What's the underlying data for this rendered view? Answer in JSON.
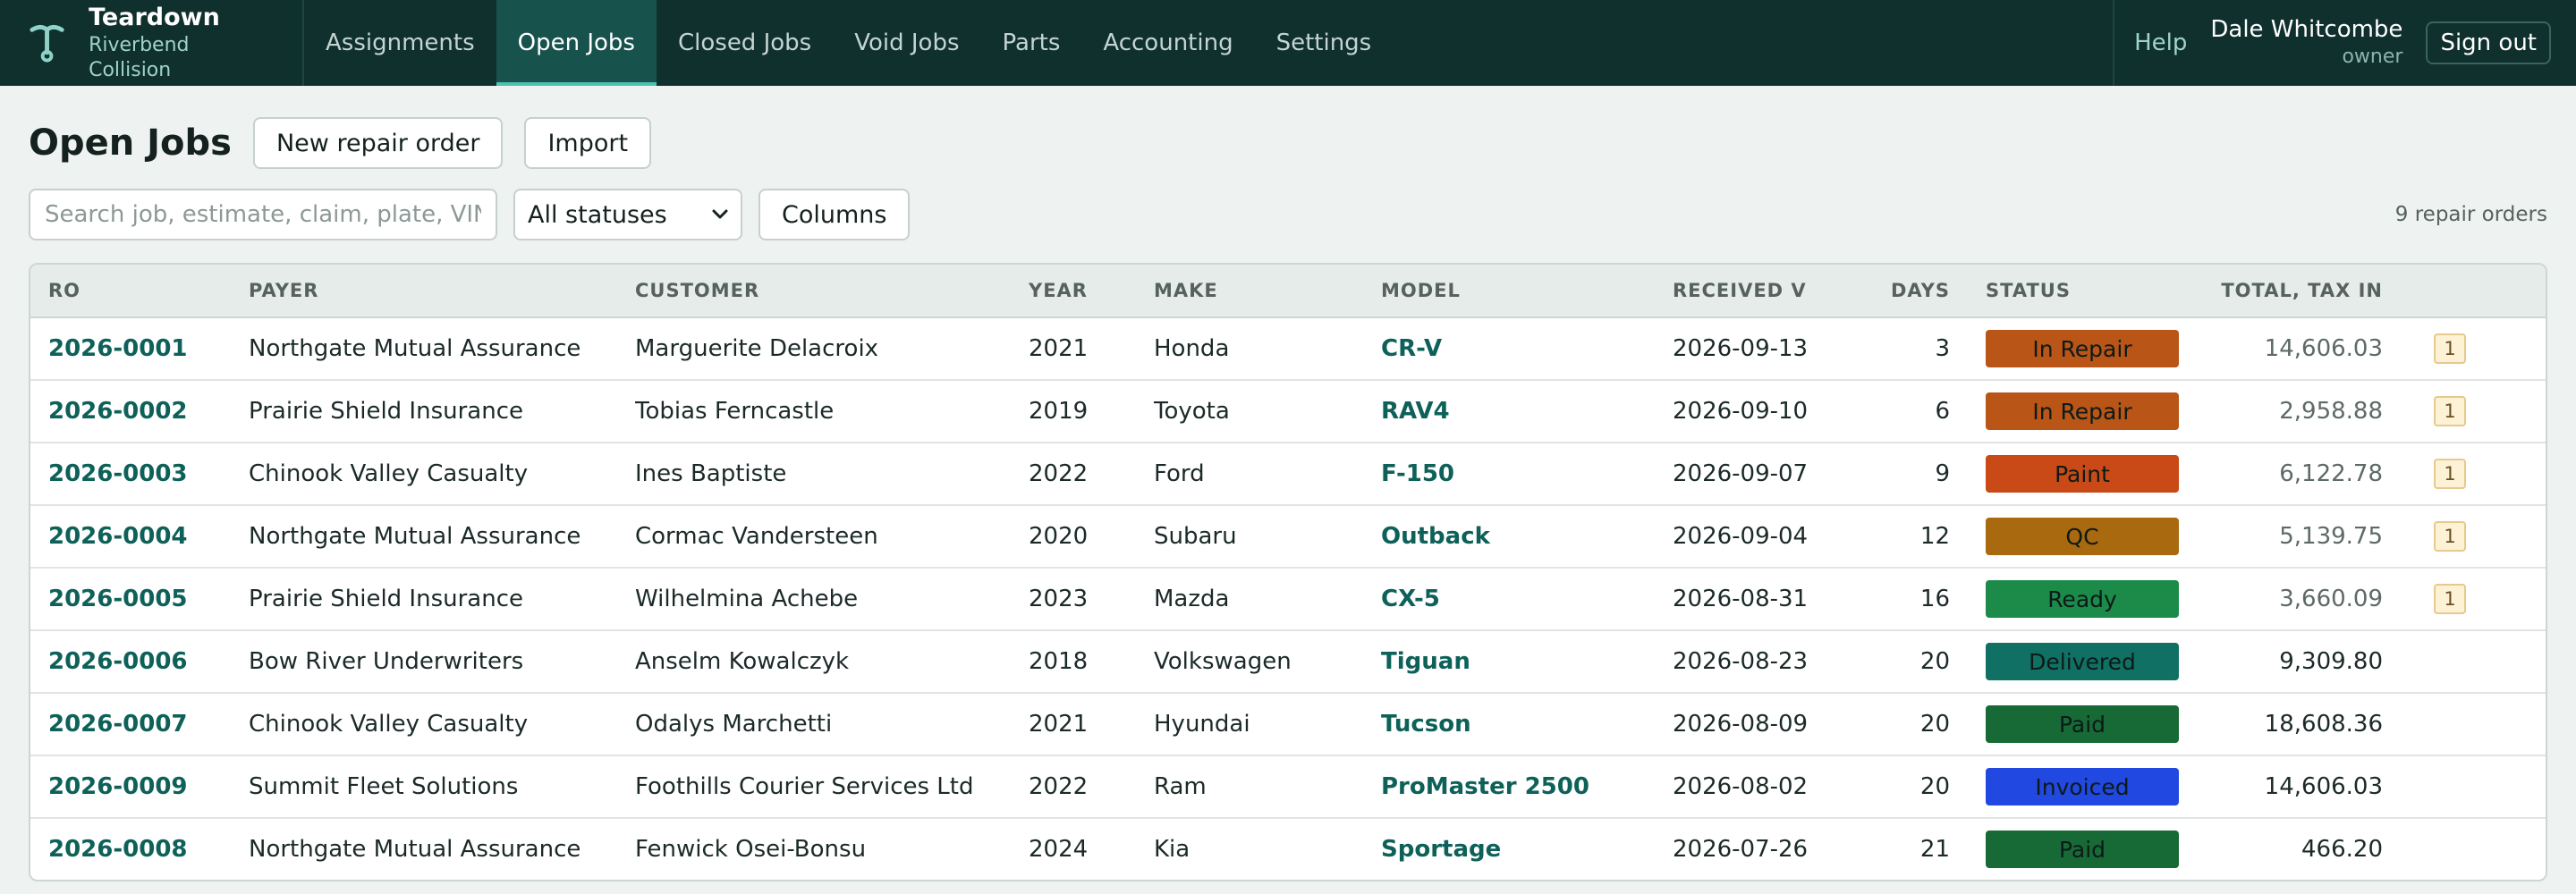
{
  "brand": {
    "name": "Teardown",
    "sub": "Riverbend Collision"
  },
  "nav": [
    {
      "label": "Assignments",
      "active": false
    },
    {
      "label": "Open Jobs",
      "active": true
    },
    {
      "label": "Closed Jobs",
      "active": false
    },
    {
      "label": "Void Jobs",
      "active": false
    },
    {
      "label": "Parts",
      "active": false
    },
    {
      "label": "Accounting",
      "active": false
    },
    {
      "label": "Settings",
      "active": false
    }
  ],
  "topright": {
    "help": "Help",
    "user_name": "Dale Whitcombe",
    "user_role": "owner",
    "signout": "Sign out"
  },
  "page": {
    "title": "Open Jobs",
    "new_btn": "New repair order",
    "import_btn": "Import"
  },
  "filters": {
    "search_placeholder": "Search job, estimate, claim, plate, VIN, customer",
    "status_selected": "All statuses",
    "columns_btn": "Columns",
    "count": "9 repair orders"
  },
  "table": {
    "headers": {
      "ro": "RO",
      "payer": "PAYER",
      "customer": "CUSTOMER",
      "year": "YEAR",
      "make": "MAKE",
      "model": "MODEL",
      "received": "RECEIVED V",
      "days": "DAYS",
      "status": "STATUS",
      "total": "TOTAL, TAX IN"
    },
    "status_colors": {
      "In Repair": "#b95516",
      "Paint": "#c94a16",
      "QC": "#a9690f",
      "Ready": "#1c8a49",
      "Delivered": "#117064",
      "Paid": "#176a36",
      "Invoiced": "#2148e0"
    },
    "rows": [
      {
        "ro": "2026-0001",
        "payer": "Northgate Mutual Assurance",
        "customer": "Marguerite Delacroix",
        "year": "2021",
        "make": "Honda",
        "model": "CR-V",
        "received": "2026-09-13",
        "days": "3",
        "status": "In Repair",
        "total": "14,606.03",
        "flag": "1"
      },
      {
        "ro": "2026-0002",
        "payer": "Prairie Shield Insurance",
        "customer": "Tobias Ferncastle",
        "year": "2019",
        "make": "Toyota",
        "model": "RAV4",
        "received": "2026-09-10",
        "days": "6",
        "status": "In Repair",
        "total": "2,958.88",
        "flag": "1"
      },
      {
        "ro": "2026-0003",
        "payer": "Chinook Valley Casualty",
        "customer": "Ines Baptiste",
        "year": "2022",
        "make": "Ford",
        "model": "F-150",
        "received": "2026-09-07",
        "days": "9",
        "status": "Paint",
        "total": "6,122.78",
        "flag": "1"
      },
      {
        "ro": "2026-0004",
        "payer": "Northgate Mutual Assurance",
        "customer": "Cormac Vandersteen",
        "year": "2020",
        "make": "Subaru",
        "model": "Outback",
        "received": "2026-09-04",
        "days": "12",
        "status": "QC",
        "total": "5,139.75",
        "flag": "1"
      },
      {
        "ro": "2026-0005",
        "payer": "Prairie Shield Insurance",
        "customer": "Wilhelmina Achebe",
        "year": "2023",
        "make": "Mazda",
        "model": "CX-5",
        "received": "2026-08-31",
        "days": "16",
        "status": "Ready",
        "total": "3,660.09",
        "flag": "1"
      },
      {
        "ro": "2026-0006",
        "payer": "Bow River Underwriters",
        "customer": "Anselm Kowalczyk",
        "year": "2018",
        "make": "Volkswagen",
        "model": "Tiguan",
        "received": "2026-08-23",
        "days": "20",
        "status": "Delivered",
        "total": "9,309.80",
        "flag": ""
      },
      {
        "ro": "2026-0007",
        "payer": "Chinook Valley Casualty",
        "customer": "Odalys Marchetti",
        "year": "2021",
        "make": "Hyundai",
        "model": "Tucson",
        "received": "2026-08-09",
        "days": "20",
        "status": "Paid",
        "total": "18,608.36",
        "flag": ""
      },
      {
        "ro": "2026-0009",
        "payer": "Summit Fleet Solutions",
        "customer": "Foothills Courier Services Ltd",
        "year": "2022",
        "make": "Ram",
        "model": "ProMaster 2500",
        "received": "2026-08-02",
        "days": "20",
        "status": "Invoiced",
        "total": "14,606.03",
        "flag": ""
      },
      {
        "ro": "2026-0008",
        "payer": "Northgate Mutual Assurance",
        "customer": "Fenwick Osei-Bonsu",
        "year": "2024",
        "make": "Kia",
        "model": "Sportage",
        "received": "2026-07-26",
        "days": "21",
        "status": "Paid",
        "total": "466.20",
        "flag": ""
      }
    ]
  }
}
